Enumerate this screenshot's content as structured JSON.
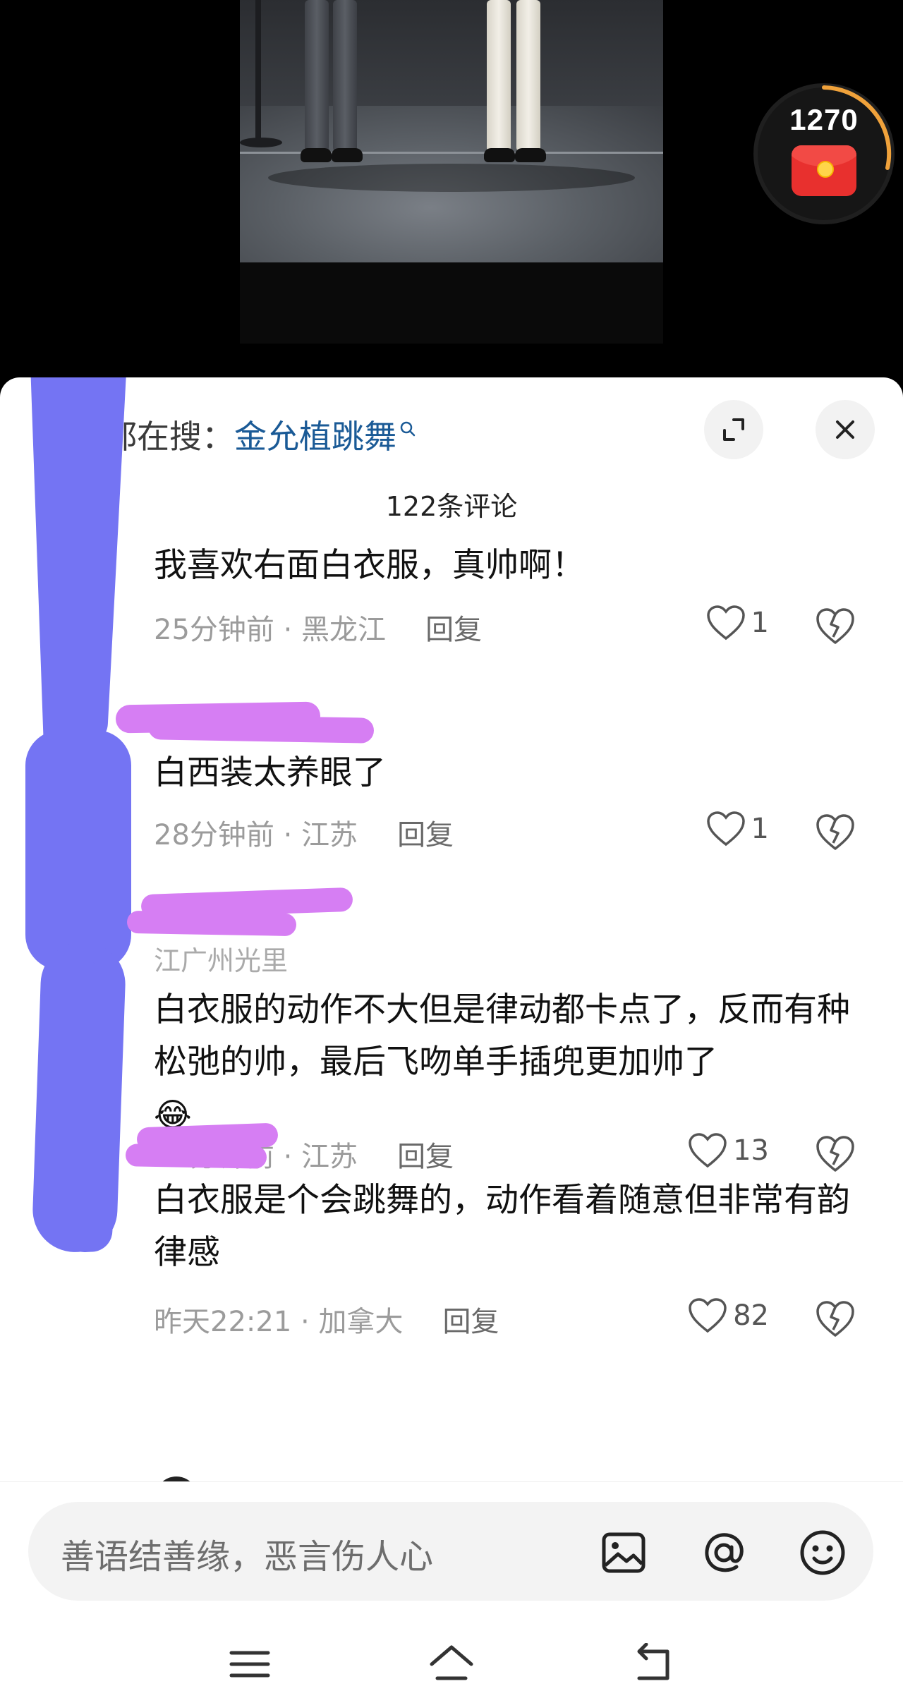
{
  "video": {
    "red_packet_count": "1270"
  },
  "sheet": {
    "hot_search_label": "大家都在搜：",
    "hot_search_term": "金允植跳舞",
    "comment_count": "122条评论"
  },
  "comments": [
    {
      "text": "我喜欢右面白衣服，真帅啊！",
      "time": "25分钟前",
      "location": "黑龙江",
      "reply_label": "回复",
      "likes": "1"
    },
    {
      "text": "白西装太养眼了",
      "time": "28分钟前",
      "location": "江苏",
      "reply_label": "回复",
      "likes": "1"
    },
    {
      "name": "江广州光里",
      "text": "白衣服的动作不大但是律动都卡点了，反而有种松弛的帅，最后飞吻单手插兜更加帅了",
      "emoji": "😂",
      "time": "53分钟前",
      "location": "江苏",
      "reply_label": "回复",
      "likes": "13"
    },
    {
      "text": "白衣服是个会跳舞的，动作看着随意但非常有韵律感",
      "time": "昨天22:21",
      "location": "加拿大",
      "reply_label": "回复",
      "likes": "82"
    }
  ],
  "input": {
    "placeholder": "善语结善缘，恶言伤人心"
  },
  "icons": {
    "expand": "expand-icon",
    "close": "close-icon",
    "like": "heart-icon",
    "dislike": "broken-heart-icon",
    "image": "image-icon",
    "mention": "at-icon",
    "emoji": "emoji-icon",
    "menu": "menu-icon",
    "home": "home-icon",
    "back": "back-icon"
  },
  "colors": {
    "hot_search_term": "#1a5a96",
    "red_packet": "#e8302e",
    "redaction_blue": "#7474f3",
    "redaction_pink": "#d67ef3"
  }
}
